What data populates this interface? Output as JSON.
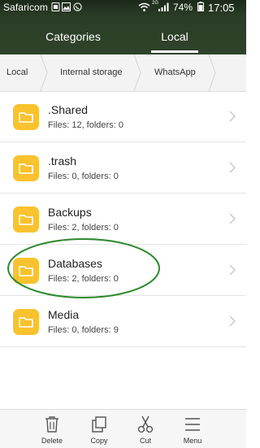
{
  "status_bar": {
    "carrier": "Safaricom",
    "network": "2G",
    "battery": "74%",
    "time": "17:05"
  },
  "tabs": [
    {
      "label": "Categories",
      "active": false
    },
    {
      "label": "Local",
      "active": true
    }
  ],
  "breadcrumb": [
    "Local",
    "Internal storage",
    "WhatsApp"
  ],
  "folders": [
    {
      "name": ".Shared",
      "info": "Files: 12, folders: 0"
    },
    {
      "name": ".trash",
      "info": "Files: 0, folders: 0"
    },
    {
      "name": "Backups",
      "info": "Files: 2, folders: 0"
    },
    {
      "name": "Databases",
      "info": "Files: 2, folders: 0"
    },
    {
      "name": "Media",
      "info": "Files: 0, folders: 9"
    }
  ],
  "actions": [
    "Delete",
    "Copy",
    "Cut",
    "Menu"
  ],
  "colors": {
    "header": "#2e432a",
    "folder": "#f9c22e",
    "highlight": "#2e8b2e"
  }
}
